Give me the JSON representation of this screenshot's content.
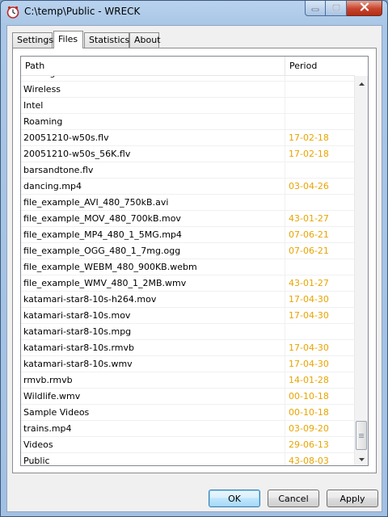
{
  "window": {
    "title": "C:\\temp\\Public - WRECK",
    "icons": {
      "app": "clock-icon",
      "minimize": "minimize-icon",
      "maximize": "maximize-icon",
      "close": "close-icon"
    }
  },
  "tabs": [
    {
      "label": "Settings",
      "active": false
    },
    {
      "label": "Files",
      "active": true
    },
    {
      "label": "Statistics",
      "active": false
    },
    {
      "label": "About",
      "active": false
    }
  ],
  "list": {
    "columns": {
      "path": "Path",
      "period": "Period"
    },
    "rows": [
      {
        "path": "Settings",
        "period": ""
      },
      {
        "path": "Wireless",
        "period": ""
      },
      {
        "path": "Intel",
        "period": ""
      },
      {
        "path": "Roaming",
        "period": ""
      },
      {
        "path": "20051210-w50s.flv",
        "period": "17-02-18"
      },
      {
        "path": "20051210-w50s_56K.flv",
        "period": "17-02-18"
      },
      {
        "path": "barsandtone.flv",
        "period": ""
      },
      {
        "path": "dancing.mp4",
        "period": "03-04-26"
      },
      {
        "path": "file_example_AVI_480_750kB.avi",
        "period": ""
      },
      {
        "path": "file_example_MOV_480_700kB.mov",
        "period": "43-01-27"
      },
      {
        "path": "file_example_MP4_480_1_5MG.mp4",
        "period": "07-06-21"
      },
      {
        "path": "file_example_OGG_480_1_7mg.ogg",
        "period": "07-06-21"
      },
      {
        "path": "file_example_WEBM_480_900KB.webm",
        "period": ""
      },
      {
        "path": "file_example_WMV_480_1_2MB.wmv",
        "period": "43-01-27"
      },
      {
        "path": "katamari-star8-10s-h264.mov",
        "period": "17-04-30"
      },
      {
        "path": "katamari-star8-10s.mov",
        "period": "17-04-30"
      },
      {
        "path": "katamari-star8-10s.mpg",
        "period": ""
      },
      {
        "path": "katamari-star8-10s.rmvb",
        "period": "17-04-30"
      },
      {
        "path": "katamari-star8-10s.wmv",
        "period": "17-04-30"
      },
      {
        "path": "rmvb.rmvb",
        "period": "14-01-28"
      },
      {
        "path": "Wildlife.wmv",
        "period": "00-10-18"
      },
      {
        "path": "Sample Videos",
        "period": "00-10-18"
      },
      {
        "path": "trains.mp4",
        "period": "03-09-20"
      },
      {
        "path": "Videos",
        "period": "29-06-13"
      },
      {
        "path": "Public",
        "period": "43-08-03"
      }
    ],
    "period_color": "#e8a400",
    "scroll_position": 0.95
  },
  "buttons": {
    "ok": "OK",
    "cancel": "Cancel",
    "apply": "Apply"
  }
}
